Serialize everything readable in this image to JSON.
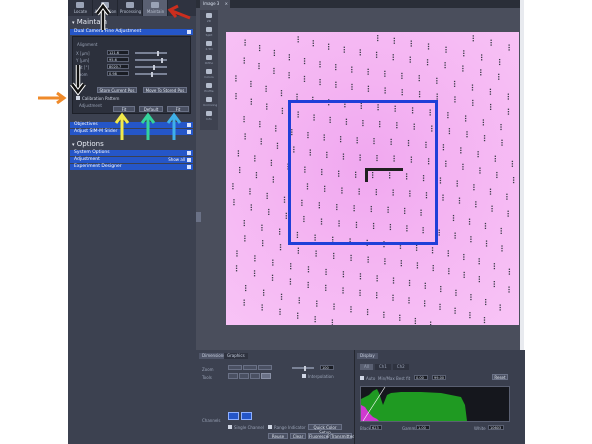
{
  "left_panel": {
    "tabs": [
      "Locate",
      "Acquisition",
      "Processing",
      "Maintain"
    ],
    "maintain_title": "Maintain",
    "dual_camera_bar": "Dual Camera Fine Adjustment",
    "alignment_label": "Alignment",
    "fields": [
      {
        "label": "X [µm]",
        "value": "121.6"
      },
      {
        "label": "Y [µm]",
        "value": "95.6"
      },
      {
        "label": "Rot [°]",
        "value": "8020.7"
      },
      {
        "label": "Zoom",
        "value": "0.98"
      }
    ],
    "store_button": "Store Current Pos",
    "move_button": "Move To Stored Pos",
    "calibration_label": "Calibration Pattern",
    "adjustment_label": "Adjustment",
    "adjust_buttons": [
      "Fit",
      "Default",
      "Fit"
    ],
    "objectives_bar": "Objectives",
    "adjust_sim_bar": "Adjust SIM-M Slider",
    "options_title": "Options",
    "option_bars": [
      "System Options",
      "Adjustment",
      "Experiment Designer"
    ],
    "show_all": "Show all"
  },
  "viewer": {
    "tab_title": "Image 3",
    "tools": [
      "2D",
      "Split",
      "2.5D",
      "Ortho",
      "Colors",
      "Profile",
      "Unmixing",
      "Info"
    ]
  },
  "bottom_left": {
    "tabs": [
      "Dimensions",
      "Graphics"
    ],
    "zoom_label": "Zoom",
    "tools_label": "Tools",
    "zoom_value": "100",
    "interpolation_label": "Interpolation",
    "channels_label": "Channels",
    "single_channel_label": "Single Channel",
    "range_indicator_label": "Range Indicator",
    "quick_color_button": "Quick Color Setup",
    "reuse_button": "Reuse",
    "bottom_buttons": [
      "Clear",
      "Fluorescence",
      "Transmitted"
    ]
  },
  "bottom_right": {
    "tabs": [
      "Display"
    ],
    "subtabs": [
      "All",
      "Ch1",
      "Ch2"
    ],
    "auto_label": "Auto",
    "min_max_label": "Min/Max",
    "best_fit_label": "Best fit",
    "value_1": "0.00",
    "value_2": "99.00",
    "reset_button": "Reset",
    "black_label": "Black",
    "black_value": "623",
    "gamma_label": "Gamma",
    "gamma_value": "1.00",
    "white_label": "White",
    "white_value": "10603"
  },
  "colors": {
    "image_pink": "#f4b4f2",
    "selection_box": "#1f3fd8",
    "arrow_black": "#111111",
    "arrow_red": "#cc2e1e",
    "arrow_orange": "#ef8a2a",
    "arrow_yellow": "#f2ea4a",
    "arrow_green": "#34d49c",
    "arrow_cyan": "#3fb0e8",
    "histogram_green": "#1f9a22"
  }
}
